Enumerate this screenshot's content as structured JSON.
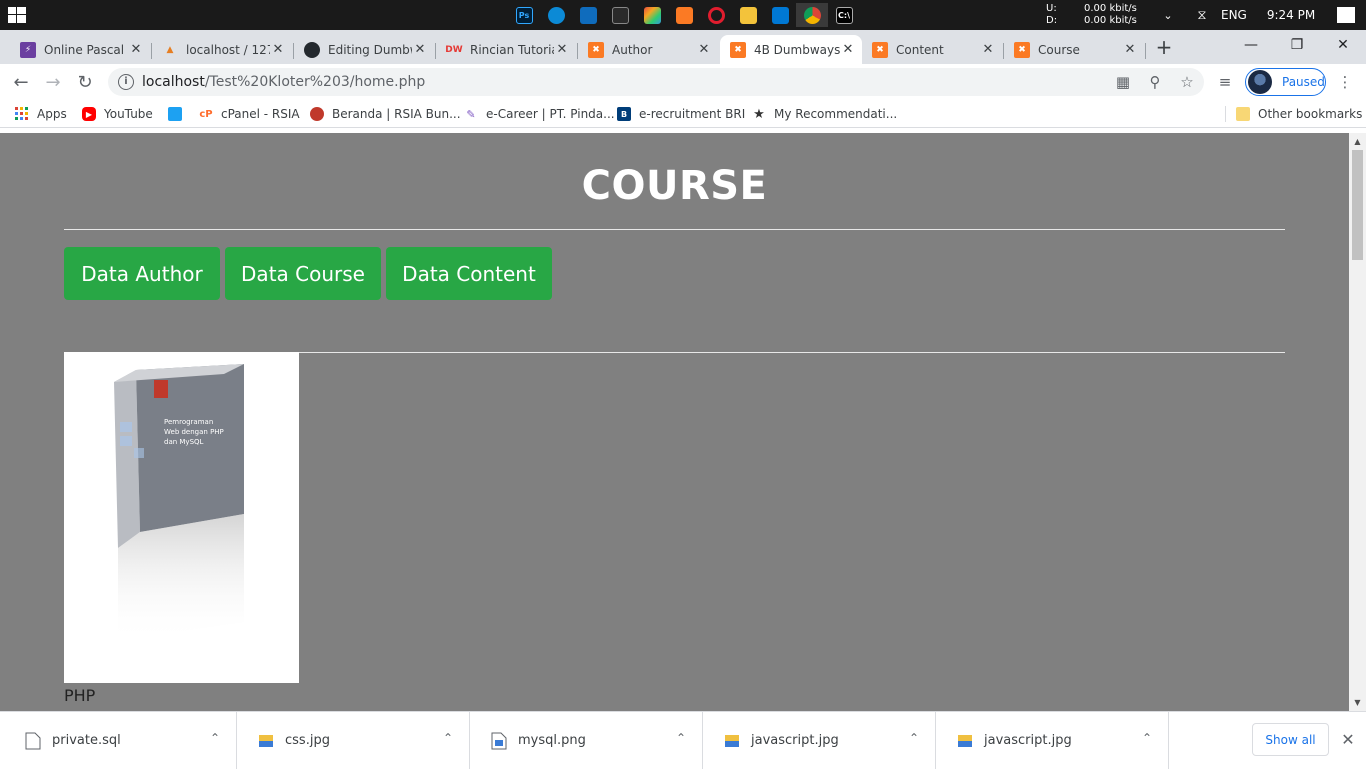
{
  "taskbar": {
    "net_up_label": "U:",
    "net_up_value": "0.00 kbit/s",
    "net_down_label": "D:",
    "net_down_value": "0.00 kbit/s",
    "language": "ENG",
    "time": "9:24 PM"
  },
  "tabs": [
    {
      "label": "Online Pascal C"
    },
    {
      "label": "localhost / 127"
    },
    {
      "label": "Editing Dumbw"
    },
    {
      "label": "Rincian Tutoria"
    },
    {
      "label": "Author"
    },
    {
      "label": "4B Dumbways"
    },
    {
      "label": "Content"
    },
    {
      "label": "Course"
    }
  ],
  "omnibox": {
    "host": "localhost",
    "path": "/Test%20Kloter%203/home.php"
  },
  "profile": {
    "label": "Paused"
  },
  "bookmarks": [
    {
      "label": "Apps"
    },
    {
      "label": "YouTube"
    },
    {
      "label": "cPanel - RSIA"
    },
    {
      "label": "Beranda | RSIA Bun..."
    },
    {
      "label": "e-Career | PT. Pinda..."
    },
    {
      "label": "e-recruitment BRI"
    },
    {
      "label": "My Recommendati..."
    }
  ],
  "other_bookmarks": "Other bookmarks",
  "page": {
    "title": "COURSE",
    "buttons": [
      {
        "label": "Data Author"
      },
      {
        "label": "Data Course"
      },
      {
        "label": "Data Content"
      }
    ],
    "course": {
      "name": "PHP",
      "cover_lines": [
        "Pemrograman",
        "Web dengan PHP",
        "dan MySQL"
      ]
    }
  },
  "downloads": [
    {
      "name": "private.sql"
    },
    {
      "name": "css.jpg"
    },
    {
      "name": "mysql.png"
    },
    {
      "name": "javascript.jpg"
    },
    {
      "name": "javascript.jpg"
    }
  ],
  "show_all": "Show all",
  "colors": {
    "page_bg": "#808080",
    "button_green": "#28a745",
    "link_blue": "#1a73e8"
  }
}
